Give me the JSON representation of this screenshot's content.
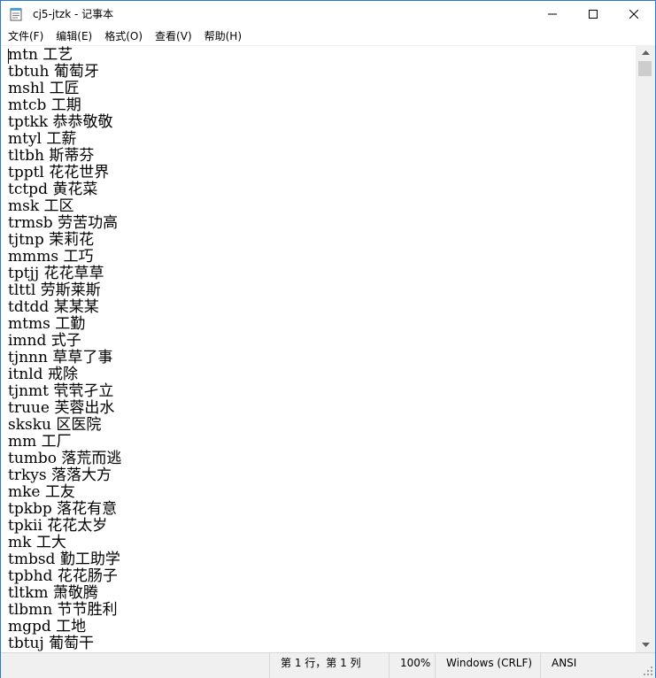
{
  "window": {
    "title": "cj5-jtzk - 记事本",
    "icon": "notepad-icon"
  },
  "title_buttons": {
    "minimize_icon": "minimize-icon",
    "maximize_icon": "maximize-icon",
    "close_icon": "close-icon"
  },
  "menu": {
    "items": [
      "文件(F)",
      "编辑(E)",
      "格式(O)",
      "查看(V)",
      "帮助(H)"
    ]
  },
  "editor": {
    "lines": [
      "mtn 工艺",
      "tbtuh 葡萄牙",
      "mshl 工匠",
      "mtcb 工期",
      "tptkk 恭恭敬敬",
      "mtyl 工薪",
      "tltbh 斯蒂芬",
      "tpptl 花花世界",
      "tctpd 黄花菜",
      "msk 工区",
      "trmsb 劳苦功高",
      "tjtnp 茉莉花",
      "mmms 工巧",
      "tptjj 花花草草",
      "tlttl 劳斯莱斯",
      "tdtdd 某某某",
      "mtms 工勤",
      "imnd 式子",
      "tjnnn 草草了事",
      "itnld 戒除",
      "tjnmt 茕茕孑立",
      "truue 芙蓉出水",
      "sksku 区医院",
      "mm 工厂",
      "tumbo 落荒而逃",
      "trkys 落落大方",
      "mke 工友",
      "tpkbp 落花有意",
      "tpkii 花花太岁",
      "mk 工大",
      "tmbsd 勤工助学",
      "tpbhd 花花肠子",
      "tltkm 萧敬腾",
      "tlbmn 节节胜利",
      "mgpd 工地",
      "tbtuj 葡萄干"
    ]
  },
  "statusbar": {
    "position": "第 1 行，第 1 列",
    "zoom": "100%",
    "line_ending": "Windows (CRLF)",
    "encoding": "ANSI"
  },
  "colors": {
    "window_border": "#2b79d6",
    "statusbar_bg": "#f0f0f0",
    "scrollbar_bg": "#f0f0f0",
    "scroll_thumb": "#cdcdcd"
  }
}
